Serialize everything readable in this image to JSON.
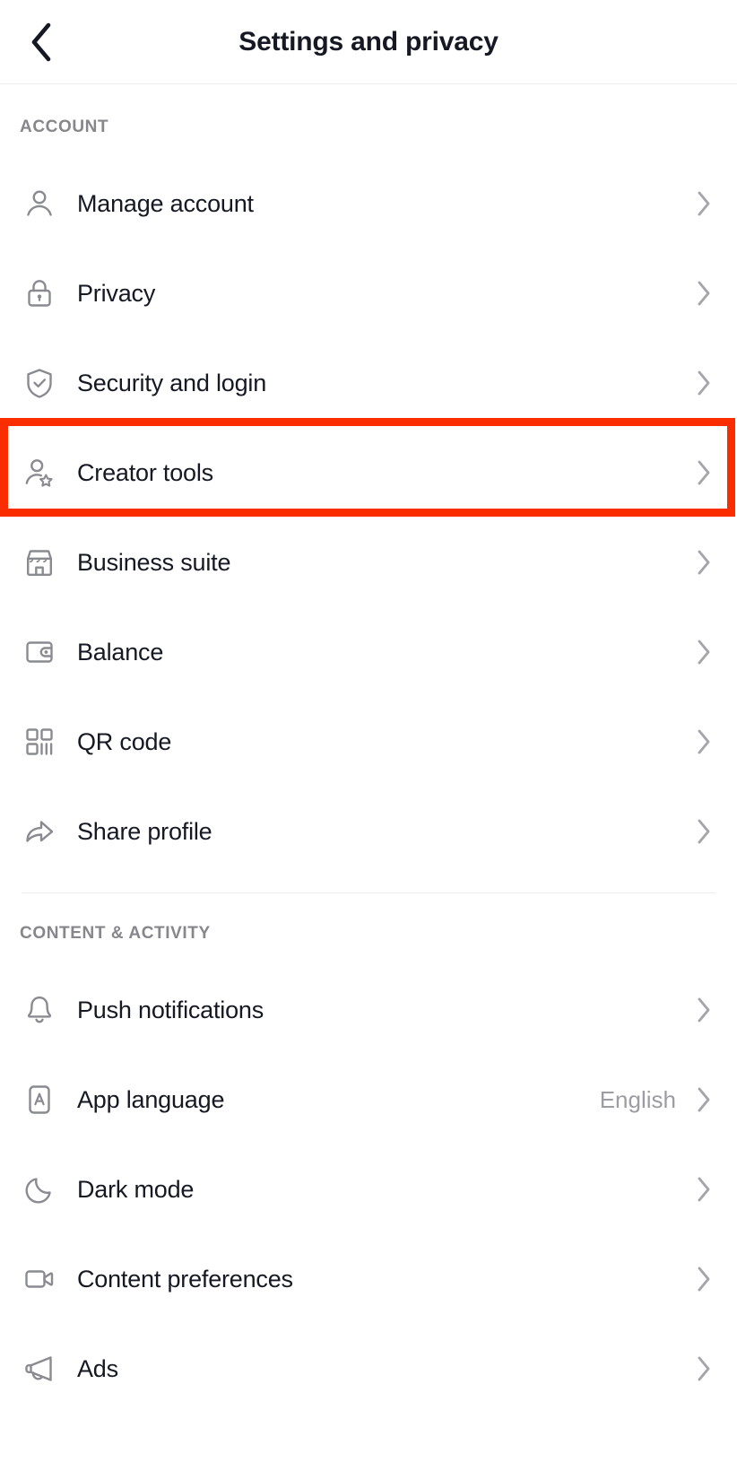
{
  "header": {
    "title": "Settings and privacy",
    "back_icon": "chevron-left-icon"
  },
  "sections": [
    {
      "id": "account",
      "title": "ACCOUNT",
      "items": [
        {
          "label": "Manage account",
          "icon": "person-icon",
          "value": "",
          "chevron": "chevron-right-icon"
        },
        {
          "label": "Privacy",
          "icon": "lock-icon",
          "value": "",
          "chevron": "chevron-right-icon"
        },
        {
          "label": "Security and login",
          "icon": "shield-check-icon",
          "value": "",
          "chevron": "chevron-right-icon"
        },
        {
          "label": "Creator tools",
          "icon": "person-star-icon",
          "value": "",
          "chevron": "chevron-right-icon",
          "highlighted": true
        },
        {
          "label": "Business suite",
          "icon": "storefront-icon",
          "value": "",
          "chevron": "chevron-right-icon"
        },
        {
          "label": "Balance",
          "icon": "wallet-icon",
          "value": "",
          "chevron": "chevron-right-icon"
        },
        {
          "label": "QR code",
          "icon": "qr-code-icon",
          "value": "",
          "chevron": "chevron-right-icon"
        },
        {
          "label": "Share profile",
          "icon": "share-arrow-icon",
          "value": "",
          "chevron": "chevron-right-icon"
        }
      ]
    },
    {
      "id": "content_activity",
      "title": "CONTENT & ACTIVITY",
      "items": [
        {
          "label": "Push notifications",
          "icon": "bell-icon",
          "value": "",
          "chevron": "chevron-right-icon"
        },
        {
          "label": "App language",
          "icon": "language-a-icon",
          "value": "English",
          "chevron": "chevron-right-icon"
        },
        {
          "label": "Dark mode",
          "icon": "moon-icon",
          "value": "",
          "chevron": "chevron-right-icon"
        },
        {
          "label": "Content preferences",
          "icon": "video-camera-icon",
          "value": "",
          "chevron": "chevron-right-icon"
        },
        {
          "label": "Ads",
          "icon": "megaphone-icon",
          "value": "",
          "chevron": "chevron-right-icon"
        }
      ]
    }
  ],
  "highlight": {
    "target_label": "Creator tools",
    "color": "#f92d00"
  },
  "colors": {
    "background": "#ffffff",
    "title_text": "#161823",
    "section_header_text": "#86868b",
    "icon": "#8a8b91",
    "value_text": "#9c9ca3",
    "chevron": "#a4a4ab",
    "divider": "#eceded",
    "highlight_red": "#f92d00"
  }
}
